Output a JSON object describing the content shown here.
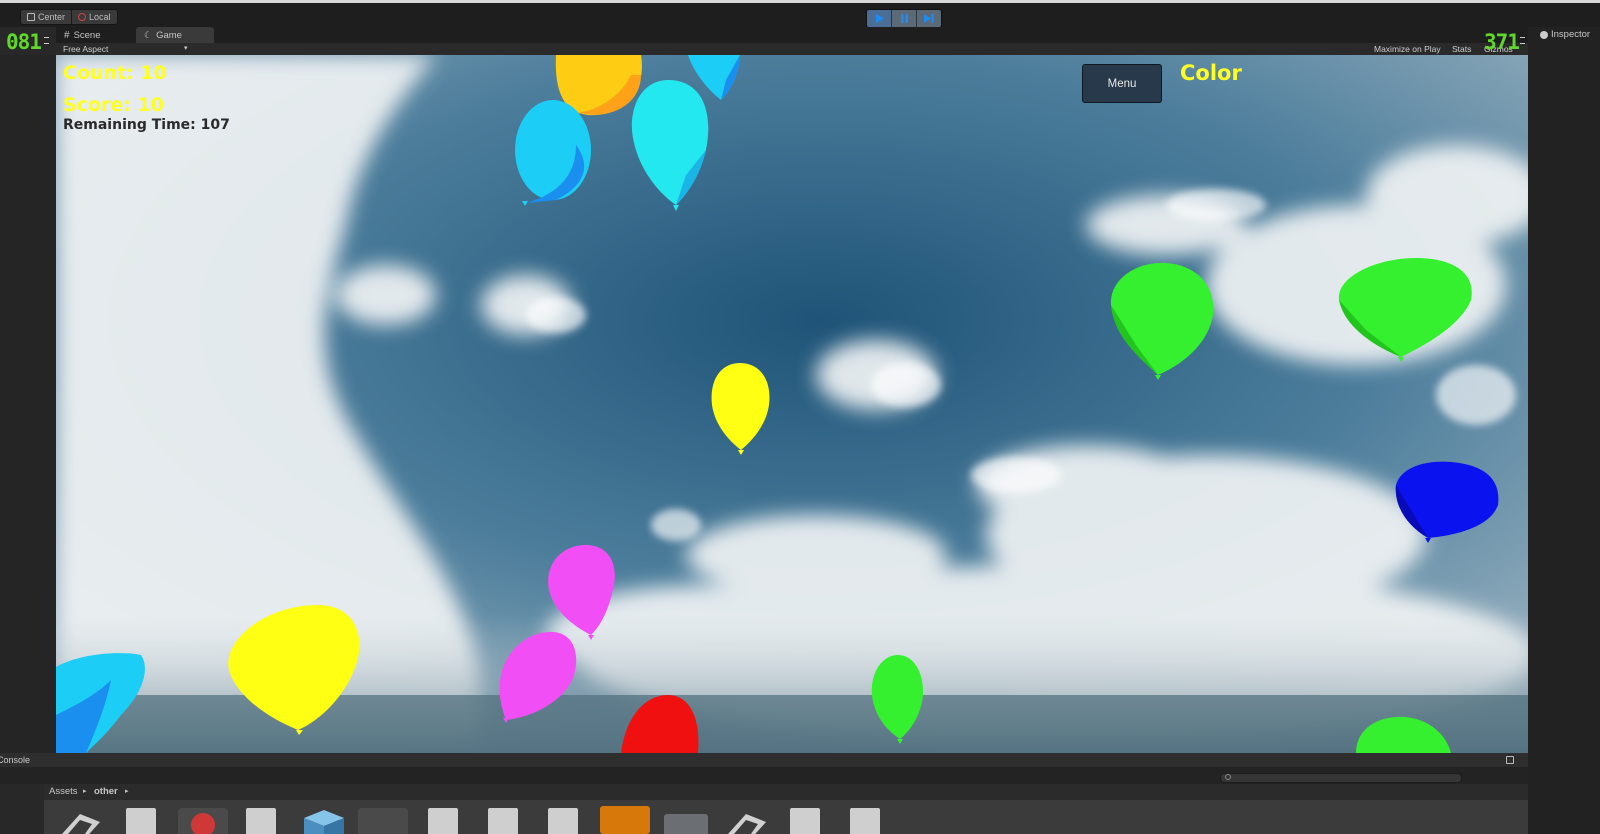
{
  "toolbar": {
    "pivot_center": "Center",
    "pivot_local": "Local",
    "fps_left": "081",
    "fps_right": "371"
  },
  "tabs": {
    "scene": "Scene",
    "game": "Game",
    "inspector": "Inspector"
  },
  "game_options": {
    "aspect": "Free Aspect",
    "maximize": "Maximize on Play",
    "stats": "Stats",
    "gizmos": "Gizmos"
  },
  "hud": {
    "count": "Count: 10",
    "score": "Score: 10",
    "remaining_time": "Remaining Time: 107",
    "menu": "Menu",
    "target_color": "Color"
  },
  "console": {
    "label": "Console"
  },
  "project": {
    "breadcrumb_root": "Assets",
    "breadcrumb_current": "other"
  },
  "colors": {
    "hud_yellow": "#ffff24",
    "balloon_yellow": "#ffff14",
    "balloon_cyan": "#24e8f0",
    "balloon_lightblue": "#1ccdf5",
    "balloon_green": "#35f02e",
    "balloon_magenta": "#f24ef5",
    "balloon_blue": "#0b12f0",
    "balloon_red": "#f01010",
    "balloon_orange": "#ffa21a",
    "fps_green": "#5fd82a"
  }
}
